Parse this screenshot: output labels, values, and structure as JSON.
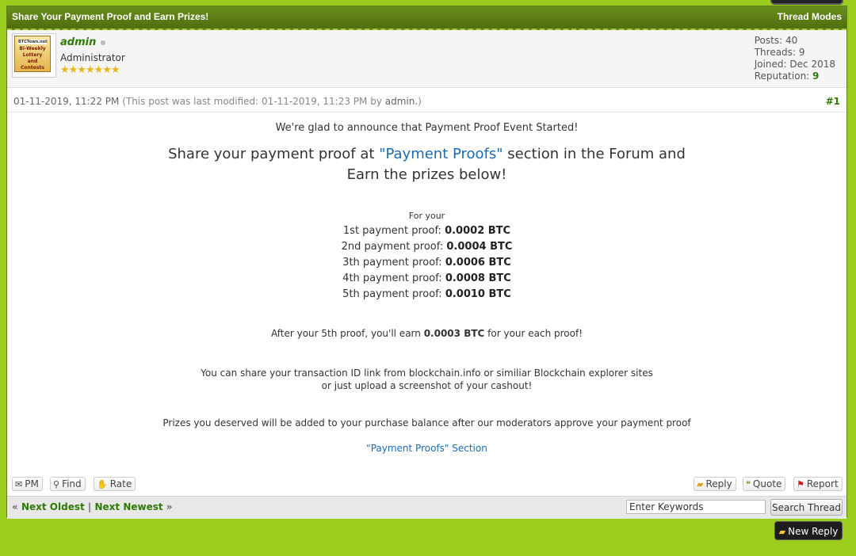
{
  "thread": {
    "title": "Share Your Payment Proof and Earn Prizes!",
    "modes_label": "Thread Modes"
  },
  "author": {
    "avatar_text": [
      "BTCTown.net",
      "Bi-Weekly",
      "Lottery",
      "and Contests"
    ],
    "username": "admin",
    "user_title": "Administrator",
    "stars": "★★★★★★★",
    "posts_label": "Posts:",
    "posts": "40",
    "threads_label": "Threads:",
    "threads": "9",
    "joined_label": "Joined:",
    "joined": "Dec 2018",
    "reputation_label": "Reputation:",
    "reputation": "9"
  },
  "post": {
    "date": "01-11-2019, 11:22 PM",
    "edited": "(This post was last modified: 01-11-2019, 11:23 PM by",
    "edited_by": "admin.",
    "edited_close": ")",
    "number": "#1",
    "line1": "We're glad to announce that Payment Proof Event Started!",
    "line2_pre": "Share your payment proof at",
    "line2_link": "\"Payment Proofs\"",
    "line2_post": "section in the Forum and",
    "line2b": "Earn the prizes below!",
    "for_your": "For your",
    "prizes": [
      {
        "label": "1st payment proof:",
        "amount": "0.0002 BTC"
      },
      {
        "label": "2nd payment proof:",
        "amount": "0.0004 BTC"
      },
      {
        "label": "3th payment proof:",
        "amount": "0.0006 BTC"
      },
      {
        "label": "4th payment proof:",
        "amount": "0.0008 BTC"
      },
      {
        "label": "5th payment proof:",
        "amount": "0.0010 BTC"
      }
    ],
    "after_pre": "After your 5th proof, you'll earn",
    "after_amount": "0.0003 BTC",
    "after_post": "for your each proof!",
    "share_line1": "You can share your transaction ID link from blockchain.info or similiar Blockchain explorer sites",
    "share_line2": "or just upload a screenshot of your cashout!",
    "prizes_note": "Prizes you deserved will be added to your purchase balance after our moderators approve your payment proof",
    "section_link": "\"Payment Proofs\" Section"
  },
  "buttons": {
    "pm": "PM",
    "find": "Find",
    "rate": "Rate",
    "reply": "Reply",
    "quote": "Quote",
    "report": "Report"
  },
  "footer": {
    "prev_arrow": "«",
    "next_oldest": "Next Oldest",
    "separator": "|",
    "next_newest": "Next Newest",
    "next_arrow": "»",
    "search_placeholder": "Enter Keywords",
    "search_button": "Search Thread"
  },
  "new_reply": "New Reply",
  "colors": {
    "page_bg": "#9acd1e",
    "header_bg": "#5a7d12",
    "link": "#1c6ab0",
    "username": "#2d7b00"
  }
}
